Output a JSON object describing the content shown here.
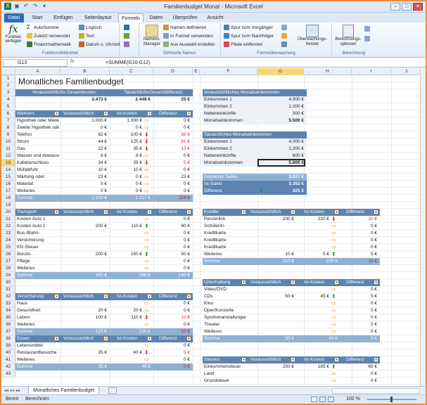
{
  "window": {
    "title": "Familienbudget Monat - Microsoft Excel"
  },
  "ribbon_tabs": [
    "Datei",
    "Start",
    "Einfügen",
    "Seitenlayout",
    "Formeln",
    "Daten",
    "Überprüfen",
    "Ansicht"
  ],
  "ribbon": {
    "func_lib": {
      "insert_fn": "Funktion einfügen",
      "autosum": "AutoSumme",
      "recent": "Zuletzt verwendet",
      "finance": "Finanzmathematik",
      "logical": "Logisch",
      "text": "Text",
      "datetime": "Datum u. Uhrzeit",
      "label": "Funktionsbibliothek"
    },
    "names": {
      "manager": "Namens-Manager",
      "define": "Namen definieren",
      "in_formula": "In Formel verwenden",
      "from_sel": "Aus Auswahl erstellen",
      "label": "Definierte Namen"
    },
    "audit": {
      "precedents": "Spur zum Vorgänger",
      "dependents": "Spur zum Nachfolger",
      "remove": "Pfeile entfernen",
      "watch": "Überwachungs-fenster",
      "label": "Formelüberwachung"
    },
    "calc": {
      "options": "Berechnungs-optionen",
      "label": "Berechnung"
    }
  },
  "formula_bar": {
    "name_box": "G13",
    "fx": "fx",
    "formula": "=SUMME(G10:G12)"
  },
  "columns": [
    "A",
    "B",
    "C",
    "D",
    "E",
    "F",
    "G",
    "H",
    "I",
    "J"
  ],
  "rows": [
    "1",
    "2",
    "3",
    "4",
    "5",
    "6",
    "7",
    "8",
    "9",
    "10",
    "11",
    "12",
    "13",
    "14",
    "15",
    "16",
    "17",
    "18",
    "19",
    "20",
    "21",
    "22",
    "23",
    "24",
    "25",
    "26",
    "27",
    "28",
    "29",
    "30",
    "31",
    "32",
    "33",
    "34",
    "35",
    "36",
    "37",
    "38",
    "39",
    "40",
    "41",
    "42",
    "43"
  ],
  "sheet": {
    "title": "Monatliches Familienbudget",
    "summary": {
      "h1": "Voraussichtliche Gesamtkosten",
      "h2": "Tatsächliche",
      "h3": "Gesamtdifferenz",
      "v1": "2.473 €",
      "v2": "2.448 €",
      "v3": "25 €"
    },
    "col_heads": {
      "plan": "Voraussichtlich",
      "act": "Ist-Kosten",
      "diff": "Differenz"
    },
    "sum_label": "Summe",
    "wohnen": {
      "head": "Wohnen",
      "rows": [
        [
          "Hypothek oder Miete",
          "1.000 €",
          "1.000 €",
          "0 €",
          "right"
        ],
        [
          "Zweite Hypothek oder",
          "0 €",
          "0 €",
          "0 €",
          "right"
        ],
        [
          "Telefon",
          "62 €",
          "100 €",
          "38 €",
          "down"
        ],
        [
          "Strom",
          "44 €",
          "125 €",
          "81 €",
          "down"
        ],
        [
          "Gas",
          "22 €",
          "35 €",
          "13 €",
          "down"
        ],
        [
          "Wasser und Abwasser",
          "8 €",
          "8 €",
          "0 €",
          "right"
        ],
        [
          "Kabelanschluss",
          "34 €",
          "39 €",
          "5 €",
          "down"
        ],
        [
          "Müllabfuhr",
          "10 €",
          "10 €",
          "0 €",
          "right"
        ],
        [
          "Wartung oder",
          "23 €",
          "0 €",
          "23 €",
          "right"
        ],
        [
          "Material",
          "0 €",
          "0 €",
          "0 €",
          "right"
        ],
        [
          "Weiteres",
          "0 €",
          "0 €",
          "0 €",
          "right"
        ]
      ],
      "sum": [
        "1.203 €",
        "1.317 €",
        "114 €"
      ]
    },
    "transport": {
      "head": "Transport",
      "rows": [
        [
          "Kosten Auto 1",
          "",
          "",
          "0 €",
          "right"
        ],
        [
          "Kosten Auto 2",
          "200 €",
          "110 €",
          "90 €",
          "up"
        ],
        [
          "Bus-/Bahn-",
          "",
          "",
          "0 €",
          "right"
        ],
        [
          "Versicherung",
          "",
          "",
          "0 €",
          "right"
        ],
        [
          "Kfz-Steuer",
          "",
          "",
          "0 €",
          "right"
        ],
        [
          "Benzin",
          "200 €",
          "150 €",
          "50 €",
          "up"
        ],
        [
          "Pflege",
          "",
          "",
          "0 €",
          "right"
        ],
        [
          "Weiteres",
          "",
          "",
          "0 €",
          "right"
        ]
      ],
      "sum": [
        "400 €",
        "260 €",
        "140 €"
      ]
    },
    "versicherung": {
      "head": "Versicherung",
      "rows": [
        [
          "Haus",
          "",
          "",
          "0 €",
          "right"
        ],
        [
          "Gesundheit",
          "20 €",
          "20 €",
          "0 €",
          "right"
        ],
        [
          "Leben",
          "100 €",
          "110 €",
          "10 €",
          "down"
        ],
        [
          "Weiteres",
          "",
          "",
          "0 €",
          "right"
        ]
      ],
      "sum": [
        "120 €",
        "130 €",
        "10 €"
      ]
    },
    "essen": {
      "head": "Essen",
      "rows": [
        [
          "Lebensmittel",
          "",
          "",
          "0 €",
          "right"
        ],
        [
          "Restaurantbesuche",
          "35 €",
          "40 €",
          "5 €",
          "down"
        ],
        [
          "Weiteres",
          "",
          "",
          "0 €",
          "right"
        ]
      ],
      "sum": [
        "35 €",
        "40 €",
        "5 €"
      ]
    },
    "plan_income": {
      "head": "Voraussichtliches Monatseinkommen",
      "rows": [
        [
          "Einkommen 1",
          "4.000 €"
        ],
        [
          "Einkommen 2",
          "1.200 €"
        ],
        [
          "Nebeneinkünfte",
          "300 €"
        ],
        [
          "Monatseinkommen",
          "5.500 €"
        ]
      ]
    },
    "actual_income": {
      "head": "Tatsächliches Monatseinkommen",
      "rows": [
        [
          "Einkommen 1",
          "4.000 €"
        ],
        [
          "Einkommen 2",
          "1.200 €"
        ],
        [
          "Nebeneinkünfte",
          "600 €"
        ],
        [
          "Monatseinkommen",
          "5.800 €"
        ]
      ]
    },
    "balance": {
      "rows": [
        [
          "Geplanter Saldo",
          "3.027 €"
        ],
        [
          "Ist-Saldo",
          "3.352 €"
        ],
        [
          "Differenz",
          "325 €"
        ]
      ]
    },
    "kredite": {
      "head": "Kredite",
      "rows": [
        [
          "Persönlich",
          "200 €",
          "220 €",
          "20 €",
          "down"
        ],
        [
          "Schüler/in",
          "",
          "",
          "0 €",
          "right"
        ],
        [
          "Kreditkarte",
          "",
          "",
          "0 €",
          "right"
        ],
        [
          "Kreditkarte",
          "",
          "",
          "0 €",
          "right"
        ],
        [
          "Kreditkarte",
          "",
          "",
          "0 €",
          "right"
        ],
        [
          "Weiteres",
          "10 €",
          "5 €",
          "5 €",
          "up"
        ]
      ],
      "sum": [
        "210 €",
        "225 €",
        "15 €"
      ]
    },
    "unterhaltung": {
      "head": "Unterhaltung",
      "rows": [
        [
          "Video/DVD",
          "",
          "",
          "0 €",
          "right"
        ],
        [
          "CDs",
          "50 €",
          "45 €",
          "5 €",
          "up"
        ],
        [
          "Kino",
          "",
          "",
          "0 €",
          "right"
        ],
        [
          "Oper/Konzerte",
          "",
          "",
          "0 €",
          "right"
        ],
        [
          "Sportveranstaltungen",
          "",
          "",
          "0 €",
          "right"
        ],
        [
          "Theater",
          "",
          "",
          "0 €",
          "right"
        ],
        [
          "Weiteres",
          "",
          "",
          "0 €",
          "right"
        ]
      ],
      "sum": [
        "50 €",
        "45 €",
        "5 €"
      ]
    },
    "steuern": {
      "head": "Steuern",
      "rows": [
        [
          "Einkommensteuer",
          "250 €",
          "185 €",
          "65 €",
          "up"
        ],
        [
          "Land",
          "",
          "",
          "0 €",
          "right"
        ],
        [
          "Grundsteuer",
          "",
          "",
          "0 €",
          "right"
        ]
      ]
    }
  },
  "sheet_tab": "Monatliches Familienbudget",
  "status": {
    "ready": "Bereit",
    "calc": "Berechnen",
    "zoom": "100 %"
  }
}
